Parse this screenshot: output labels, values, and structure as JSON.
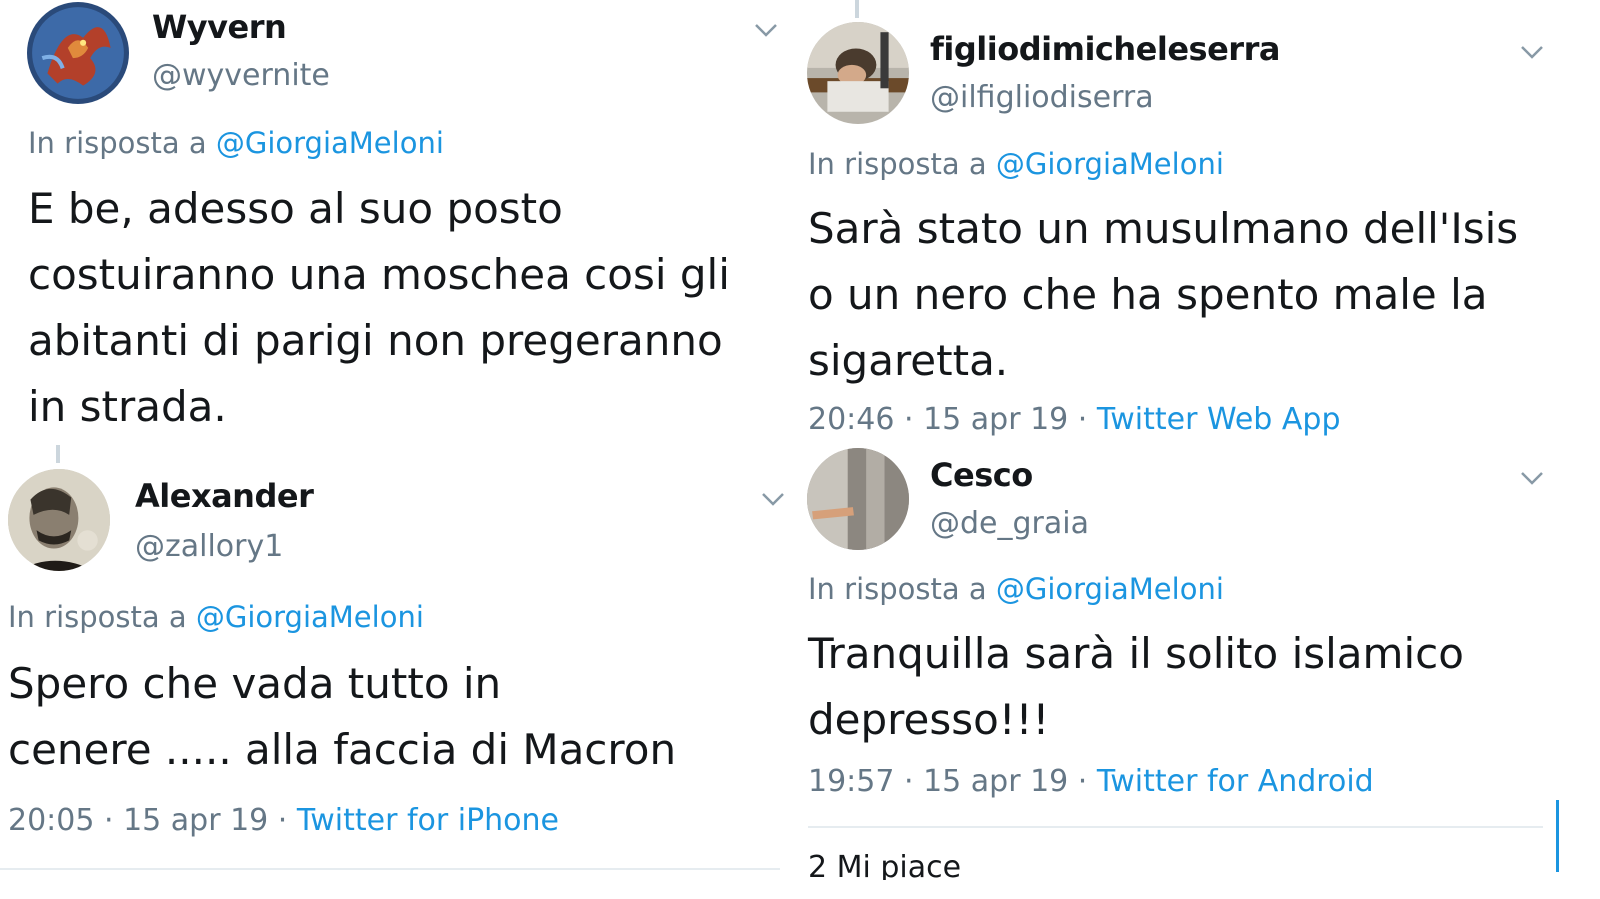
{
  "tweets": [
    {
      "name": "Wyvern",
      "handle": "@wyvernite",
      "reply_prefix": "In risposta a ",
      "reply_to": "@GiorgiaMeloni",
      "lines": [
        "E be, adesso al suo posto",
        "costuiranno una moschea cosi gli",
        "abitanti di parigi non pregeranno",
        "in strada."
      ]
    },
    {
      "name": "Alexander",
      "handle": "@zallory1",
      "reply_prefix": "In risposta a ",
      "reply_to": "@GiorgiaMeloni",
      "lines": [
        "Spero che vada tutto in",
        "cenere ..... alla faccia di Macron"
      ],
      "time": "20:05 · 15 apr 19 · ",
      "source": "Twitter for iPhone"
    },
    {
      "name": "figliodimicheleserra",
      "handle": "@ilfigliodiserra",
      "reply_prefix": "In risposta a ",
      "reply_to": "@GiorgiaMeloni",
      "lines": [
        "Sarà stato un musulmano dell'Isis",
        "o un nero che ha spento male la",
        "sigaretta."
      ],
      "time": "20:46 · 15 apr 19 · ",
      "source": "Twitter Web App"
    },
    {
      "name": "Cesco",
      "handle": "@de_graia",
      "reply_prefix": "In risposta a ",
      "reply_to": "@GiorgiaMeloni",
      "lines": [
        "Tranquilla sarà il solito islamico",
        "depresso!!!"
      ],
      "time": "19:57 · 15 apr 19 · ",
      "source": "Twitter for Android",
      "likes": "2 Mi piace"
    }
  ],
  "colors": {
    "text": "#14171a",
    "secondary": "#657786",
    "link": "#1b95e0",
    "divider": "#e6ecf0"
  },
  "icons": {
    "menu": "chevron-down-icon",
    "avatar": "avatar-image"
  }
}
